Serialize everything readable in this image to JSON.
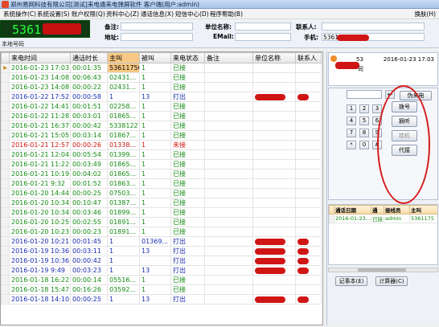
{
  "window": {
    "title": "郑州易网科技有限公司[测试]来电通来电弹屏软件 客户端(用户:admin)"
  },
  "menu": {
    "items": [
      "系统操作(C)",
      "系统设置(S)",
      "账户权限(Q)",
      "资料中心(Z)",
      "通话信息(X)",
      "短信中心(D)",
      "程序帮助(B)"
    ],
    "exit": "换肤(H)"
  },
  "top_panel": {
    "caller_number": "5361",
    "local_label": "本地号码",
    "remark_label": "备注:",
    "company_label": "单位名称:",
    "contact_label": "联系人:",
    "address_label": "地址:",
    "email_label": "EMail:",
    "mobile_label": "手机:",
    "mobile_value": "5361"
  },
  "call_table": {
    "columns": [
      "来电时间",
      "通话时长",
      "主叫",
      "被叫",
      "来电状态",
      "备注",
      "单位名称",
      "联系人"
    ],
    "rows": [
      {
        "time": "2016-01-23 17:03",
        "duration": "00:01:35",
        "caller": "53611750",
        "callee": "1",
        "status": "已接",
        "kind": "answered"
      },
      {
        "time": "2016-01-23 14:08",
        "duration": "00:06:43",
        "caller": "02431...",
        "callee": "1",
        "status": "已接",
        "kind": "answered"
      },
      {
        "time": "2016-01-23 14:08",
        "duration": "00:00:22",
        "caller": "02431...",
        "callee": "1",
        "status": "已接",
        "kind": "answered"
      },
      {
        "time": "2016-01-22 17:52",
        "duration": "00:00:58",
        "caller": "1",
        "callee": "13",
        "status": "打出",
        "kind": "out"
      },
      {
        "time": "2016-01-22 14:41",
        "duration": "00:01:51",
        "caller": "02258...",
        "callee": "1",
        "status": "已接",
        "kind": "answered"
      },
      {
        "time": "2016-01-22 11:28",
        "duration": "00:03:01",
        "caller": "01865...",
        "callee": "1",
        "status": "已接",
        "kind": "answered"
      },
      {
        "time": "2016-01-21 16:37",
        "duration": "00:00:42",
        "caller": "53381227",
        "callee": "1",
        "status": "已接",
        "kind": "answered"
      },
      {
        "time": "2016-01-21 15:05",
        "duration": "00:03:14",
        "caller": "01867...",
        "callee": "1",
        "status": "已接",
        "kind": "answered"
      },
      {
        "time": "2016-01-21 12:57",
        "duration": "00:00:26",
        "caller": "01338...",
        "callee": "1",
        "status": "未接",
        "kind": "missed"
      },
      {
        "time": "2016-01-21 12:04",
        "duration": "00:05:54",
        "caller": "01399...",
        "callee": "1",
        "status": "已接",
        "kind": "answered"
      },
      {
        "time": "2016-01-21 11:22",
        "duration": "00:03:49",
        "caller": "01865...",
        "callee": "1",
        "status": "已接",
        "kind": "answered"
      },
      {
        "time": "2016-01-21 10:19",
        "duration": "00:04:02",
        "caller": "01865...",
        "callee": "1",
        "status": "已接",
        "kind": "answered"
      },
      {
        "time": "2016-01-21 9:32",
        "duration": "00:01:52",
        "caller": "01863...",
        "callee": "1",
        "status": "已接",
        "kind": "answered"
      },
      {
        "time": "2016-01-20 14:44",
        "duration": "00:00:25",
        "caller": "07503...",
        "callee": "1",
        "status": "已接",
        "kind": "answered"
      },
      {
        "time": "2016-01-20 10:34",
        "duration": "00:10:47",
        "caller": "01387...",
        "callee": "1",
        "status": "已接",
        "kind": "answered"
      },
      {
        "time": "2016-01-20 10:34",
        "duration": "00:03:46",
        "caller": "01899...",
        "callee": "1",
        "status": "已接",
        "kind": "answered"
      },
      {
        "time": "2016-01-20 10:25",
        "duration": "00:02:55",
        "caller": "01891...",
        "callee": "1",
        "status": "已接",
        "kind": "answered"
      },
      {
        "time": "2016-01-20 10:23",
        "duration": "00:00:23",
        "caller": "01891...",
        "callee": "1",
        "status": "已接",
        "kind": "answered"
      },
      {
        "time": "2016-01-20 10:21",
        "duration": "00:01:45",
        "caller": "1",
        "callee": "01369...",
        "status": "打出",
        "kind": "out"
      },
      {
        "time": "2016-01-19 10:36",
        "duration": "00:03:11",
        "caller": "1",
        "callee": "13",
        "status": "打出",
        "kind": "out"
      },
      {
        "time": "2016-01-19 10:36",
        "duration": "00:00:42",
        "caller": "1",
        "callee": "",
        "status": "打出",
        "kind": "out"
      },
      {
        "time": "2016-01-19 9:49",
        "duration": "00:03:23",
        "caller": "1",
        "callee": "13",
        "status": "打出",
        "kind": "out"
      },
      {
        "time": "2016-01-18 16:22",
        "duration": "00:00:14",
        "caller": "05516...",
        "callee": "1",
        "status": "已接",
        "kind": "answered"
      },
      {
        "time": "2016-01-18 15:47",
        "duration": "00:16:26",
        "caller": "03592...",
        "callee": "1",
        "status": "已接",
        "kind": "answered"
      },
      {
        "time": "2016-01-18 14:10",
        "duration": "00:00:25",
        "caller": "1",
        "callee": "13",
        "status": "打出",
        "kind": "out"
      }
    ]
  },
  "side_panel": {
    "detail_number": "53",
    "detail_time": "2016-01-23 17:03",
    "detail_name": "司",
    "redial": "伪来电",
    "keys": [
      "1",
      "2",
      "3",
      "4",
      "5",
      "6",
      "7",
      "8",
      "9",
      "*",
      "0",
      "#"
    ],
    "buttons": [
      {
        "label": "拨号",
        "disabled": false
      },
      {
        "label": "摘听",
        "disabled": false
      },
      {
        "label": "挂机",
        "disabled": true
      },
      {
        "label": "代接",
        "disabled": false
      }
    ],
    "sub_columns": [
      "通话日期",
      "通",
      "接线员",
      "主叫"
    ],
    "sub_row": {
      "date": "2016-01-23...",
      "status": "已接",
      "operator": "admin",
      "caller": "5361175"
    },
    "memo_button": "记事本(E)",
    "calc_button": "计算器(C)"
  },
  "colors": {
    "answered": "#148a14",
    "outgoing": "#1a2cb0",
    "missed": "#cf1111",
    "highlight": "#f7c985",
    "callout": "#d41c1c"
  },
  "icons": [
    "app-icon",
    "row-indicator-icon",
    "backspace-icon"
  ]
}
